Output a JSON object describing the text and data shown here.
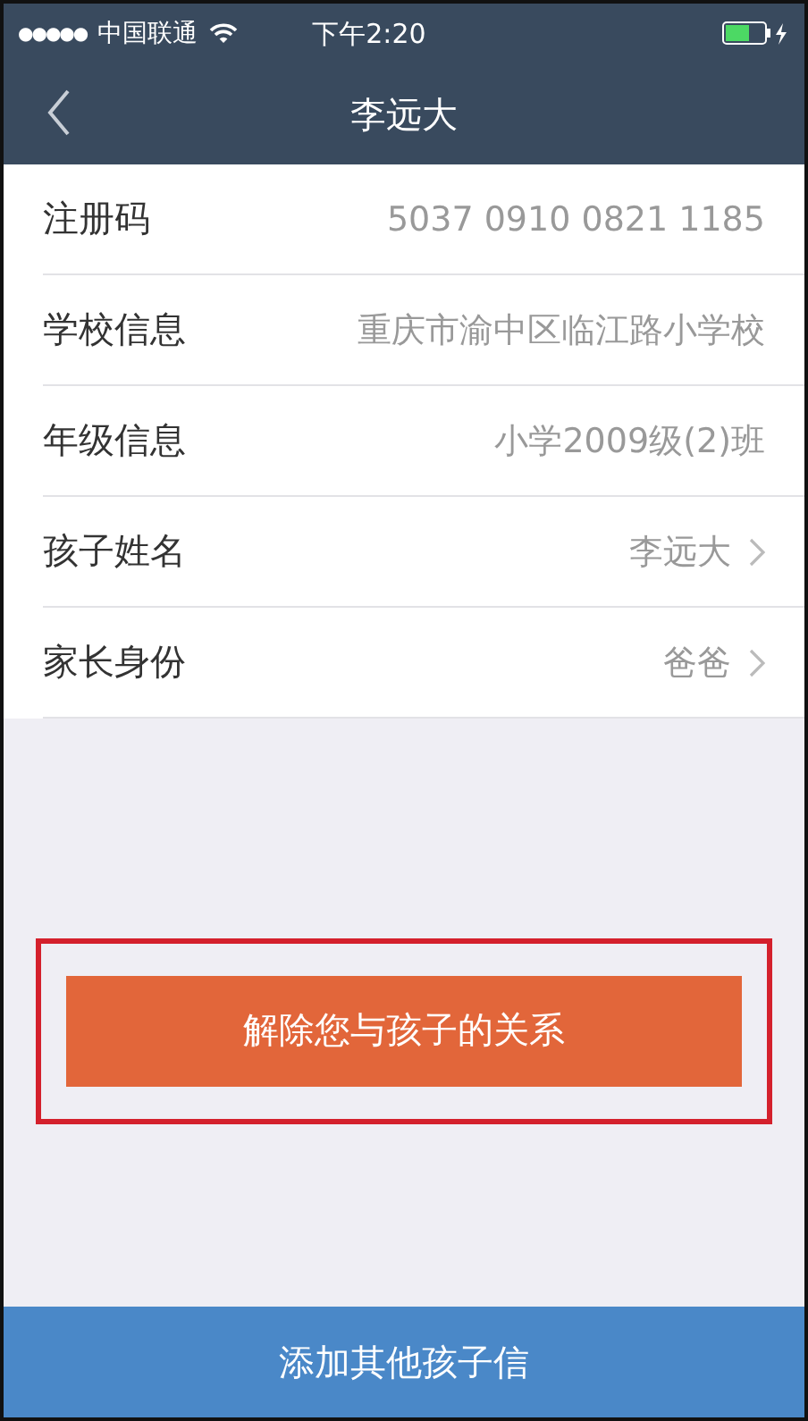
{
  "status_bar": {
    "signal_dots": "●●●●●",
    "carrier": "中国联通",
    "time": "下午2:20"
  },
  "nav_bar": {
    "title": "李远大"
  },
  "rows": [
    {
      "label": "注册码",
      "value": "5037 0910 0821 1185",
      "kind": "info"
    },
    {
      "label": "学校信息",
      "value": "重庆市渝中区临江路小学校",
      "kind": "info"
    },
    {
      "label": "年级信息",
      "value": "小学2009级(2)班",
      "kind": "info"
    },
    {
      "label": "孩子姓名",
      "value": "李远大",
      "kind": "link"
    },
    {
      "label": "家长身份",
      "value": "爸爸",
      "kind": "link"
    }
  ],
  "unbind_button": {
    "label": "解除您与孩子的关系",
    "highlighted": true
  },
  "bottom_button": {
    "label": "添加其他孩子信"
  }
}
